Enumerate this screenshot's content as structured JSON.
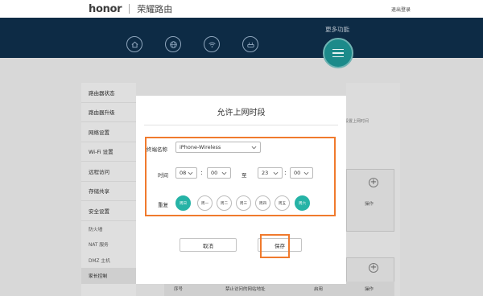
{
  "header": {
    "brand": "honor",
    "product": "荣耀路由",
    "logout": "退出登录"
  },
  "nav": {
    "more_label": "更多功能",
    "icons": [
      "home-icon",
      "globe-icon",
      "wifi-icon",
      "router-icon"
    ]
  },
  "sidebar": {
    "items": [
      "路由器状态",
      "路由器升级",
      "网络设置",
      "Wi-Fi 设置",
      "远程访问",
      "存储共享",
      "安全设置"
    ],
    "sub_items": [
      "防火墙",
      "NAT 服务",
      "DMZ 主机",
      "家长控制"
    ],
    "active_sub": "家长控制"
  },
  "background": {
    "note": "设置上网时间",
    "op_label": "操作",
    "table_cols": [
      "序号",
      "禁止访问的网站地址",
      "启用",
      "操作"
    ]
  },
  "modal": {
    "title": "允许上网时段",
    "device_label": "终端名称",
    "device_value": "iPhone-Wireless",
    "time_label": "时间",
    "start_hour": "08",
    "start_min": "00",
    "to_label": "至",
    "end_hour": "23",
    "end_min": "00",
    "colon": ":",
    "repeat_label": "重复",
    "days": [
      {
        "label": "周日",
        "selected": true
      },
      {
        "label": "周一",
        "selected": false
      },
      {
        "label": "周二",
        "selected": false
      },
      {
        "label": "周三",
        "selected": false
      },
      {
        "label": "周四",
        "selected": false
      },
      {
        "label": "周五",
        "selected": false
      },
      {
        "label": "周六",
        "selected": true
      }
    ],
    "cancel_label": "取消",
    "save_label": "保存"
  },
  "colors": {
    "accent": "#26b3a6",
    "highlight": "#f07a2d",
    "nav_bg": "#0d2b45"
  }
}
